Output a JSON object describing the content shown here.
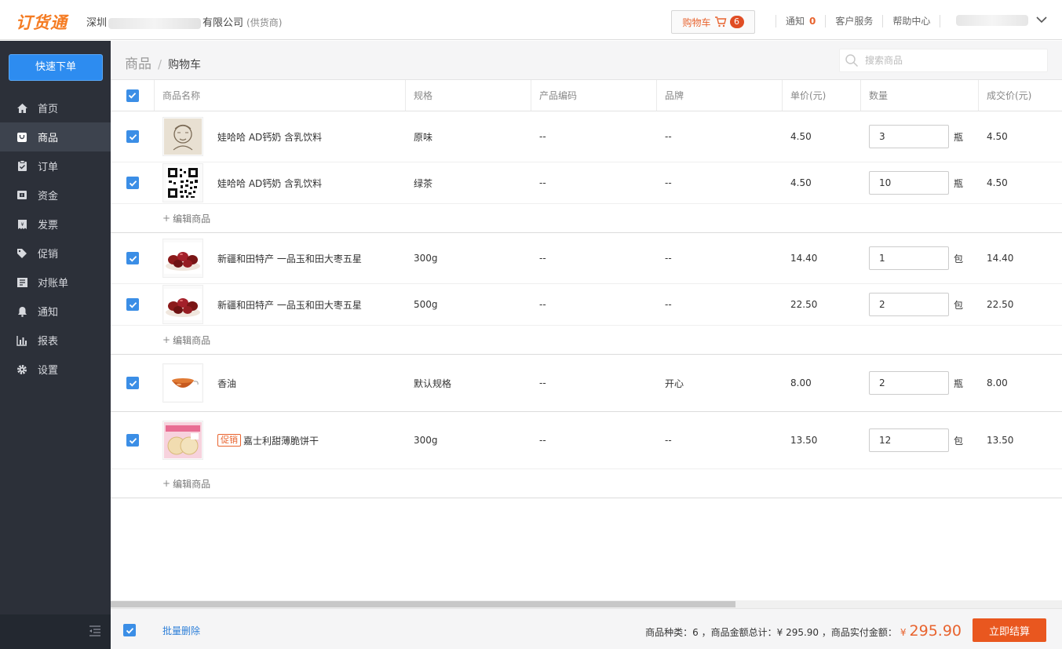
{
  "header": {
    "logo": "订货通",
    "company_prefix": "深圳",
    "company_suffix": "有限公司",
    "company_tag": "(供货商)",
    "cart_label": "购物车",
    "cart_count": "6",
    "notify_label": "通知",
    "notify_count": "0",
    "service_label": "客户服务",
    "help_label": "帮助中心"
  },
  "sidebar": {
    "quick_order": "快速下单",
    "items": [
      {
        "label": "首页",
        "icon": "home-icon"
      },
      {
        "label": "商品",
        "icon": "bag-icon",
        "active": true
      },
      {
        "label": "订单",
        "icon": "clipboard-icon"
      },
      {
        "label": "资金",
        "icon": "wallet-icon"
      },
      {
        "label": "发票",
        "icon": "invoice-icon"
      },
      {
        "label": "促销",
        "icon": "tag-icon"
      },
      {
        "label": "对账单",
        "icon": "statement-icon"
      },
      {
        "label": "通知",
        "icon": "bell-icon"
      },
      {
        "label": "报表",
        "icon": "bar-chart-icon"
      },
      {
        "label": "设置",
        "icon": "gear-icon"
      }
    ]
  },
  "breadcrumb": {
    "root": "商品",
    "separator": "/",
    "current": "购物车"
  },
  "search": {
    "placeholder": "搜索商品"
  },
  "table": {
    "columns": [
      "商品名称",
      "规格",
      "产品编码",
      "品牌",
      "单价(元)",
      "数量",
      "成交价(元)"
    ],
    "edit_label": "编辑商品",
    "groups": [
      {
        "rows": [
          {
            "name": "娃哈哈 AD钙奶 含乳饮料",
            "spec": "原味",
            "code": "--",
            "brand": "--",
            "price": "4.50",
            "qty": "3",
            "unit": "瓶",
            "deal": "4.50",
            "thumb": "sketch"
          },
          {
            "name": "娃哈哈 AD钙奶 含乳饮料",
            "spec": "绿茶",
            "code": "--",
            "brand": "--",
            "price": "4.50",
            "qty": "10",
            "unit": "瓶",
            "deal": "4.50",
            "thumb": "qr"
          }
        ],
        "editable": true
      },
      {
        "rows": [
          {
            "name": "新疆和田特产 一品玉和田大枣五星",
            "spec": "300g",
            "code": "--",
            "brand": "--",
            "price": "14.40",
            "qty": "1",
            "unit": "包",
            "deal": "14.40",
            "thumb": "dates"
          },
          {
            "name": "新疆和田特产 一品玉和田大枣五星",
            "spec": "500g",
            "code": "--",
            "brand": "--",
            "price": "22.50",
            "qty": "2",
            "unit": "包",
            "deal": "22.50",
            "thumb": "dates"
          }
        ],
        "editable": true
      },
      {
        "rows": [
          {
            "name": "香油",
            "spec": "默认规格",
            "code": "--",
            "brand": "开心",
            "price": "8.00",
            "qty": "2",
            "unit": "瓶",
            "deal": "8.00",
            "thumb": "oil"
          }
        ],
        "editable": false
      },
      {
        "rows": [
          {
            "name": "嘉士利甜薄脆饼干",
            "promo": "促销",
            "spec": "300g",
            "code": "--",
            "brand": "--",
            "price": "13.50",
            "qty": "12",
            "unit": "包",
            "deal": "13.50",
            "thumb": "biscuit"
          }
        ],
        "editable": true
      }
    ]
  },
  "footer": {
    "batch_delete": "批量删除",
    "kinds_text": "商品种类：6 ，商品金额总计：¥ 295.90 ，商品实付金额：",
    "yen": "¥",
    "total": "295.90",
    "checkout": "立即结算"
  },
  "colors": {
    "accent": "#e9571f",
    "primary": "#2d8cf0",
    "sidebar": "#2c3039"
  }
}
